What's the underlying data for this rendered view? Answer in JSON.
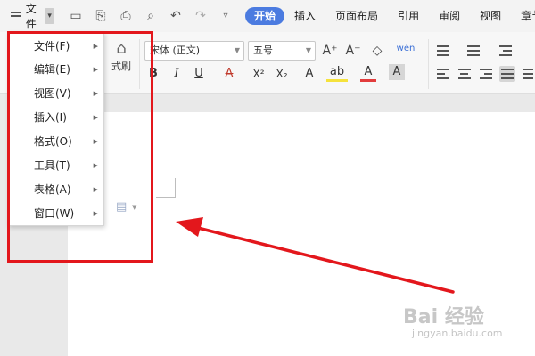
{
  "menubar": {
    "file_label": "文件",
    "tabs": [
      {
        "label": "开始",
        "active": true
      },
      {
        "label": "插入",
        "active": false
      },
      {
        "label": "页面布局",
        "active": false
      },
      {
        "label": "引用",
        "active": false
      },
      {
        "label": "审阅",
        "active": false
      },
      {
        "label": "视图",
        "active": false
      },
      {
        "label": "章节",
        "active": false
      }
    ]
  },
  "ribbon": {
    "format_painter_label": "式刷",
    "font_name": "宋体 (正文)",
    "font_size": "五号",
    "bold": "B",
    "italic": "I",
    "underline": "U",
    "strike": "A",
    "superscript": "X²",
    "subscript": "X₂",
    "text_effect": "A",
    "highlight": "ab",
    "font_color": "A",
    "char_shade": "A",
    "grow_font": "A⁺",
    "shrink_font": "A⁻",
    "pinyin": "wén"
  },
  "file_menu": {
    "items": [
      {
        "label": "文件(F)"
      },
      {
        "label": "编辑(E)"
      },
      {
        "label": "视图(V)"
      },
      {
        "label": "插入(I)"
      },
      {
        "label": "格式(O)"
      },
      {
        "label": "工具(T)"
      },
      {
        "label": "表格(A)"
      },
      {
        "label": "窗口(W)"
      }
    ]
  },
  "watermark": {
    "logo": "Bai 经验",
    "url": "jingyan.baidu.com"
  },
  "colors": {
    "active_tab": "#4b7be0",
    "annotation_red": "#e3171c",
    "highlight_yellow": "#f5e23c",
    "font_color_red": "#e23c3c"
  }
}
